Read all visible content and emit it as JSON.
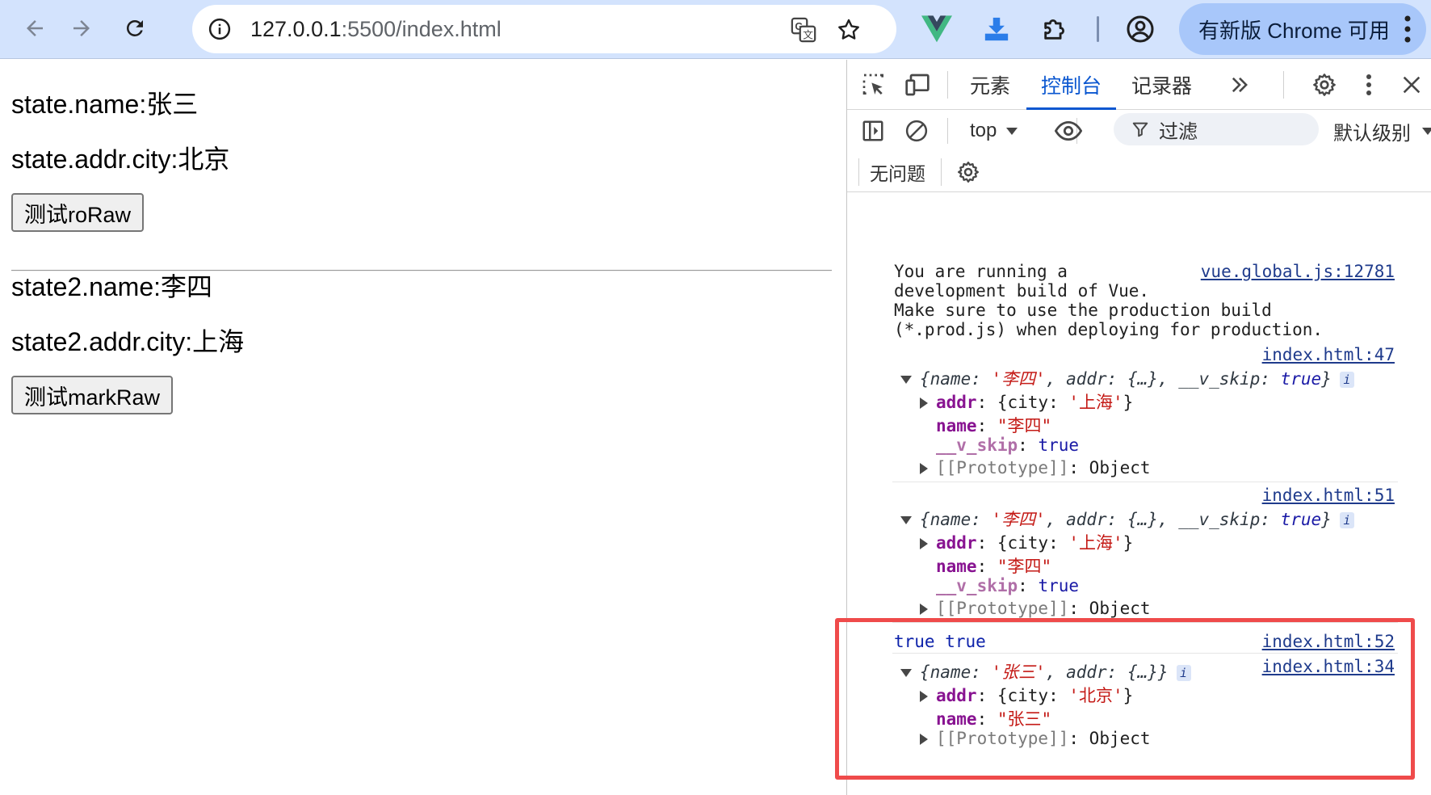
{
  "browser": {
    "url_host": "127.0.0.1",
    "url_rest": ":5500/index.html",
    "update_button": "有新版 Chrome 可用"
  },
  "page": {
    "lines": [
      "state.name:张三",
      "state.addr.city:北京",
      "state2.name:李四",
      "state2.addr.city:上海"
    ],
    "button1": "测试roRaw",
    "button2": "测试markRaw"
  },
  "devtools": {
    "tabs": [
      "元素",
      "控制台",
      "记录器"
    ],
    "active_tab": "控制台",
    "context": "top",
    "filter": "过滤",
    "level": "默认级别",
    "issues": "无问题",
    "console": {
      "vue_warning": {
        "lines": [
          "You are running a",
          "development build of Vue.",
          "Make sure to use the production build",
          "(*.prod.js) when deploying for production."
        ],
        "source": "vue.global.js:12781"
      },
      "obj1": {
        "source": "index.html:47",
        "summary_name": "'李四'",
        "summary_rest": "{…}",
        "summary_skip": "true",
        "addr_city": "'上海'",
        "name_value": "\"李四\"",
        "skip_value": "true",
        "proto": "Object"
      },
      "obj2": {
        "source": "index.html:51",
        "summary_name": "'李四'",
        "summary_rest": "{…}",
        "summary_skip": "true",
        "addr_city": "'上海'",
        "name_value": "\"李四\"",
        "skip_value": "true",
        "proto": "Object"
      },
      "bool_line": {
        "text": "true true",
        "source": "index.html:52"
      },
      "obj3": {
        "source": "index.html:34",
        "summary_name": "'张三'",
        "summary_rest": "{…}",
        "addr_city": "'北京'",
        "name_value": "\"张三\"",
        "proto": "Object"
      }
    }
  },
  "colors": {
    "toolbar_bg": "#d3e3fd",
    "highlight_box": "#ef4b4b",
    "active_tab": "#0b57d0"
  }
}
